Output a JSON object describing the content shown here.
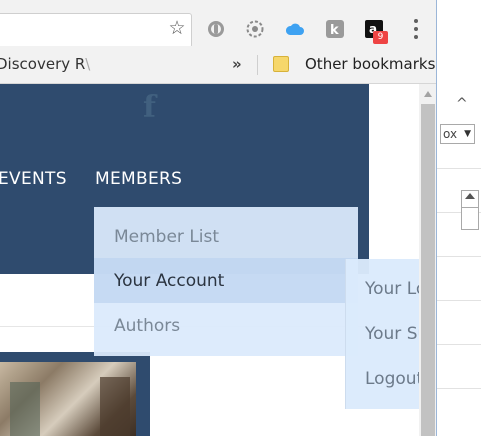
{
  "browser": {
    "bookmarks": {
      "partial_item": "Discovery R",
      "partial_fade": "\\",
      "overflow": "»",
      "other": "Other bookmarks"
    },
    "extension_badge_count": "9"
  },
  "side_panel": {
    "select_value": "ox"
  },
  "site": {
    "nav": {
      "events": "EVENTS",
      "members": "MEMBERS"
    },
    "members_menu": [
      {
        "label": "Member List"
      },
      {
        "label": "Your Account"
      },
      {
        "label": "Authors"
      }
    ],
    "account_submenu": [
      {
        "label": "Your Lo"
      },
      {
        "label": "Your Su"
      },
      {
        "label": "Logout"
      }
    ]
  },
  "colors": {
    "header_bg": "#2f4b6e",
    "dropdown_bg": "#dbeafc",
    "dropdown_text": "#7a8897",
    "dropdown_active_text": "#2b3440"
  }
}
